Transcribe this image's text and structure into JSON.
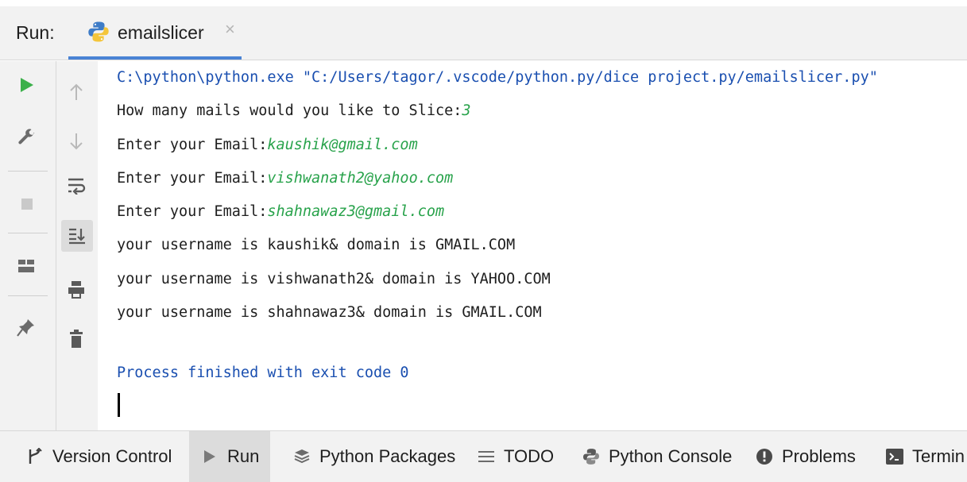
{
  "run_panel": {
    "label": "Run:",
    "tab": {
      "title": "emailslicer",
      "close": "×",
      "icon": "python-icon"
    }
  },
  "toolbar_left": {
    "items": [
      "run-icon",
      "wrench-icon",
      "stop-icon",
      "layout-icon",
      "pin-icon"
    ]
  },
  "toolbar_right": {
    "items": [
      "arrow-up-icon",
      "arrow-down-icon",
      "soft-wrap-icon",
      "scroll-to-end-icon",
      "print-icon",
      "trash-icon"
    ]
  },
  "console": {
    "command": "C:\\python\\python.exe \"C:/Users/tagor/.vscode/python.py/dice project.py/emailslicer.py\"",
    "prompt_count": "How many mails would you like to Slice:",
    "input_count": "3",
    "prompt_email": "Enter your Email:",
    "emails": [
      "kaushik@gmail.com",
      "vishwanath2@yahoo.com",
      "shahnawaz3@gmail.com"
    ],
    "results": [
      "your username is kaushik& domain is GMAIL.COM",
      "your username is vishwanath2& domain is YAHOO.COM",
      "your username is shahnawaz3& domain is GMAIL.COM"
    ],
    "exit": "Process finished with exit code 0"
  },
  "bottom_tabs": [
    {
      "label": "Version Control",
      "icon": "version-control-icon"
    },
    {
      "label": "Run",
      "icon": "run-icon",
      "active": true
    },
    {
      "label": "Python Packages",
      "icon": "packages-icon"
    },
    {
      "label": "TODO",
      "icon": "list-icon"
    },
    {
      "label": "Python Console",
      "icon": "python-icon"
    },
    {
      "label": "Problems",
      "icon": "problems-icon"
    },
    {
      "label": "Termin",
      "icon": "terminal-icon"
    }
  ],
  "colors": {
    "accent": "#4a83d4",
    "run_green": "#3bb04a",
    "input_green": "#27a24a",
    "command_blue": "#1a4fb0"
  }
}
